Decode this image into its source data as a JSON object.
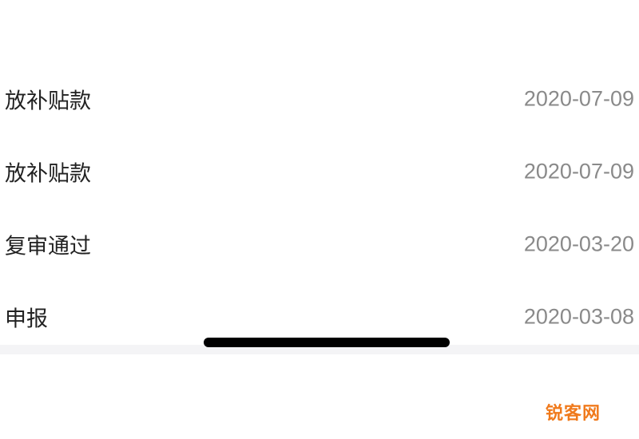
{
  "records": [
    {
      "title": "放补贴款",
      "date": "2020-07-09"
    },
    {
      "title": "放补贴款",
      "date": "2020-07-09"
    },
    {
      "title": "复审通过",
      "date": "2020-03-20"
    },
    {
      "title": "申报",
      "date": "2020-03-08"
    }
  ],
  "watermark": "锐客网",
  "colors": {
    "title_text": "#222222",
    "date_text": "#8a8a8a",
    "divider": "#e6e6e6",
    "watermark": "#f07a1c"
  }
}
